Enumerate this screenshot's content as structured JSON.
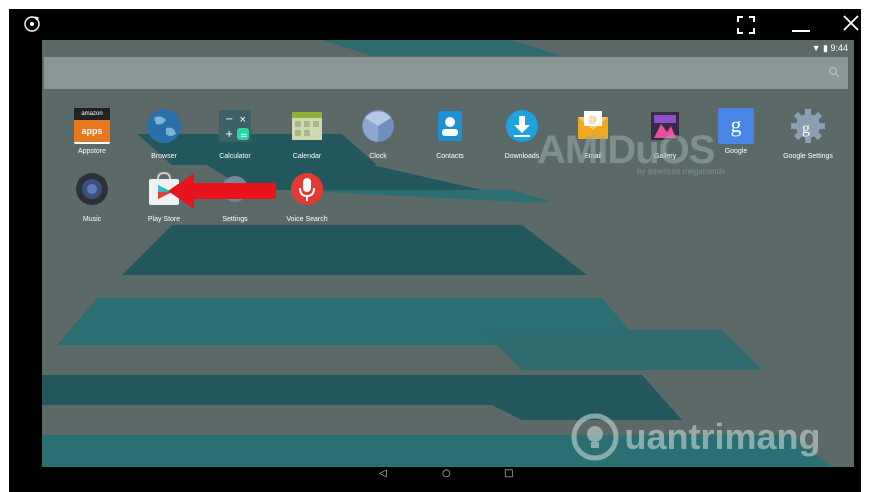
{
  "status": {
    "time": "9:44"
  },
  "search": {
    "icon": "search-icon"
  },
  "apps_row1": [
    "Appstore",
    "Browser",
    "Calculator",
    "Calendar",
    "Clock",
    "Contacts",
    "Downloads",
    "Email",
    "Gallery",
    "Google",
    "Google Settings"
  ],
  "apps_row2": [
    "Music",
    "Play Store",
    "Settings",
    "Voice Search"
  ],
  "icons": {
    "appstore_top": "amazon",
    "appstore_bottom": "apps",
    "google": "g",
    "google_settings": "g"
  },
  "watermark": {
    "amiduos": "AMIDuOS",
    "amiduos_sub": "by american megatrends",
    "site": "uantrimang"
  },
  "colors": {
    "wallpaper": "#5b6a69",
    "stripe_dark": "#22575d",
    "stripe_mid": "#2b6f73",
    "arrow": "#e8141c"
  }
}
